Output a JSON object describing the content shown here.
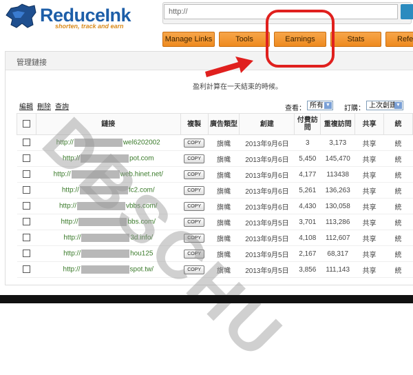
{
  "brand": {
    "name": "ReduceInk",
    "tagline": "shorten, track and earn"
  },
  "url_bar": {
    "placeholder": "http://"
  },
  "nav": [
    {
      "label": "Manage Links"
    },
    {
      "label": "Tools"
    },
    {
      "label": "Earnings"
    },
    {
      "label": "Stats"
    },
    {
      "label": "Refer"
    }
  ],
  "panel": {
    "title": "管理鏈接",
    "notice": "盈利計算在一天結束的時候。",
    "actions": [
      "編輯",
      "刪除",
      "查詢"
    ],
    "filter": {
      "view_label": "查看：",
      "view_value": "所有",
      "sort_label": "訂購：",
      "sort_value": "上次創建"
    }
  },
  "table": {
    "headers": [
      "鏈接",
      "複製",
      "廣告類型",
      "創建",
      "付費訪問",
      "重複訪問",
      "共享",
      "統"
    ],
    "rows": [
      {
        "prefix": "http://",
        "suffix": "wel6202002",
        "copy": "COPY",
        "ad": "旗幟",
        "date": "2013年9月6日",
        "paid": "3",
        "repeat": "3,173",
        "share": "共享",
        "stat": "統"
      },
      {
        "prefix": "http://",
        "suffix": "pot.com",
        "copy": "COPY",
        "ad": "旗幟",
        "date": "2013年9月6日",
        "paid": "5,450",
        "repeat": "145,470",
        "share": "共享",
        "stat": "統"
      },
      {
        "prefix": "http://",
        "suffix": "web.hinet.net/",
        "copy": "COPY",
        "ad": "旗幟",
        "date": "2013年9月6日",
        "paid": "4,177",
        "repeat": "113438",
        "share": "共享",
        "stat": "統"
      },
      {
        "prefix": "http://",
        "suffix": "fc2.com/",
        "copy": "COPY",
        "ad": "旗幟",
        "date": "2013年9月6日",
        "paid": "5,261",
        "repeat": "136,263",
        "share": "共享",
        "stat": "統"
      },
      {
        "prefix": "http://",
        "suffix": "vbbs.com/",
        "copy": "COPY",
        "ad": "旗幟",
        "date": "2013年9月6日",
        "paid": "4,430",
        "repeat": "130,058",
        "share": "共享",
        "stat": "統"
      },
      {
        "prefix": "http://",
        "suffix": "bbs.com/",
        "copy": "COPY",
        "ad": "旗幟",
        "date": "2013年9月5日",
        "paid": "3,701",
        "repeat": "113,286",
        "share": "共享",
        "stat": "統"
      },
      {
        "prefix": "http://",
        "suffix": "3d.info/",
        "copy": "COPY",
        "ad": "旗幟",
        "date": "2013年9月5日",
        "paid": "4,108",
        "repeat": "112,607",
        "share": "共享",
        "stat": "統"
      },
      {
        "prefix": "http://",
        "suffix": "hou125",
        "copy": "COPY",
        "ad": "旗幟",
        "date": "2013年9月5日",
        "paid": "2,167",
        "repeat": "68,317",
        "share": "共享",
        "stat": "統"
      },
      {
        "prefix": "http://",
        "suffix": "spot.tw/",
        "copy": "COPY",
        "ad": "旗幟",
        "date": "2013年9月5日",
        "paid": "3,856",
        "repeat": "111,143",
        "share": "共享",
        "stat": "統"
      }
    ]
  },
  "watermark": "DBSCHU",
  "colors": {
    "accent_orange": "#ee8a1f",
    "highlight_red": "#e0201e",
    "brand_blue": "#1d5ea8",
    "link_green": "#3a7a2a"
  }
}
